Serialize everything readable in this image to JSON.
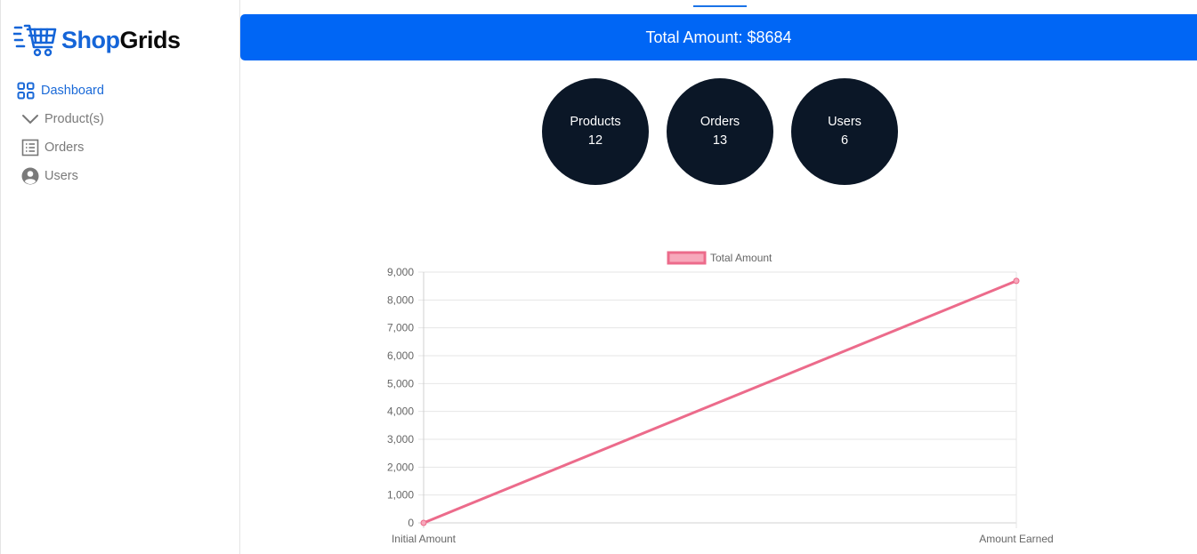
{
  "brand": {
    "part1": "Shop",
    "part2": "Grids",
    "primary": "#1565d8"
  },
  "sidebar": {
    "items": [
      {
        "label": "Dashboard",
        "icon": "dashboard-grid-icon",
        "active": true
      },
      {
        "label": "Product(s)",
        "icon": "chevron-down-icon",
        "active": false
      },
      {
        "label": "Orders",
        "icon": "list-icon",
        "active": false
      },
      {
        "label": "Users",
        "icon": "user-circle-icon",
        "active": false
      }
    ]
  },
  "banner": {
    "text": "Total Amount: $8684",
    "color": "#0066f5"
  },
  "stats": [
    {
      "label": "Products",
      "value": "12"
    },
    {
      "label": "Orders",
      "value": "13"
    },
    {
      "label": "Users",
      "value": "6"
    }
  ],
  "chart_data": {
    "type": "line",
    "categories": [
      "Initial Amount",
      "Amount Earned"
    ],
    "series": [
      {
        "name": "Total Amount",
        "values": [
          0,
          8684
        ],
        "color": "#ec6b8b",
        "fill": "#f7a8bb"
      }
    ],
    "ylim": [
      0,
      9000
    ],
    "yticks": [
      "0",
      "1,000",
      "2,000",
      "3,000",
      "4,000",
      "5,000",
      "6,000",
      "7,000",
      "8,000",
      "9,000"
    ],
    "grid": true,
    "legend": "top-center"
  }
}
